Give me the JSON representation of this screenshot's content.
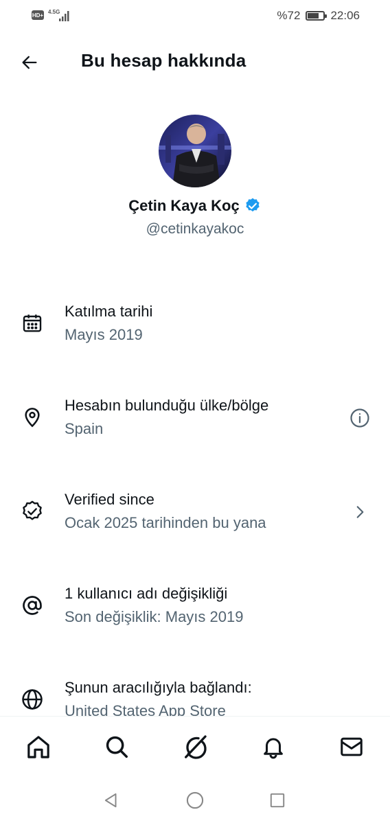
{
  "status_bar": {
    "hd_label": "HD+",
    "network_label": "4.5G",
    "battery_percent_text": "%72",
    "battery_level": 0.72,
    "time": "22:06"
  },
  "header": {
    "title": "Bu hesap hakkında",
    "back_icon": "arrow-left-icon"
  },
  "profile": {
    "display_name": "Çetin Kaya Koç",
    "handle": "@cetinkayakoc",
    "verified_icon": "verified-badge-icon",
    "verified_color": "#1d9bf0"
  },
  "info_items": [
    {
      "icon": "calendar-icon",
      "title": "Katılma tarihi",
      "subtitle": "Mayıs 2019"
    },
    {
      "icon": "location-pin-icon",
      "title": "Hesabın bulunduğu ülke/bölge",
      "subtitle": "Spain",
      "trailing_icon": "info-circle-icon"
    },
    {
      "icon": "verified-outline-icon",
      "title": "Verified since",
      "subtitle": "Ocak 2025 tarihinden bu yana",
      "trailing_icon": "chevron-right-icon"
    },
    {
      "icon": "at-sign-icon",
      "title": "1 kullanıcı adı değişikliği",
      "subtitle": "Son değişiklik: Mayıs 2019"
    },
    {
      "icon": "globe-icon",
      "title": "Şunun aracılığıyla bağlandı:",
      "subtitle": "United States App Store"
    }
  ],
  "bottom_nav": [
    {
      "icon": "home-icon"
    },
    {
      "icon": "search-icon"
    },
    {
      "icon": "grok-icon"
    },
    {
      "icon": "bell-icon"
    },
    {
      "icon": "mail-icon"
    }
  ],
  "system_nav": [
    {
      "icon": "back-triangle-icon"
    },
    {
      "icon": "home-circle-icon"
    },
    {
      "icon": "recents-square-icon"
    }
  ],
  "colors": {
    "text_primary": "#0f1419",
    "text_secondary": "#536471",
    "accent": "#1d9bf0"
  }
}
